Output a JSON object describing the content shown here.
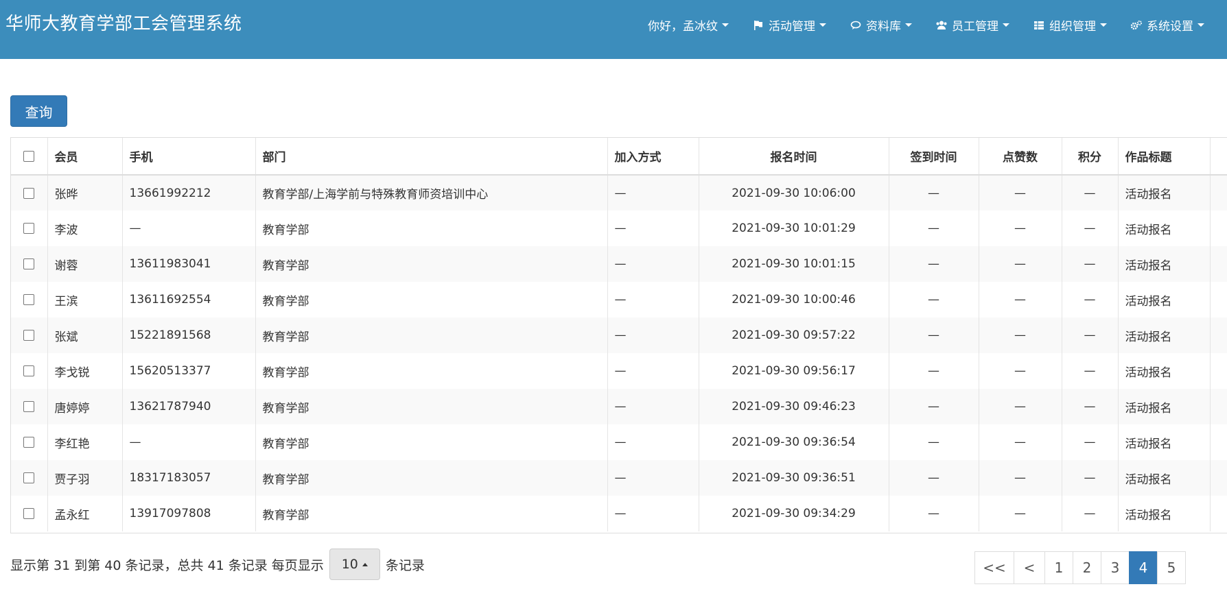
{
  "header": {
    "title": "华师大教育学部工会管理系统",
    "greeting": "你好，孟冰纹",
    "menu": [
      {
        "label": "活动管理",
        "icon": "flag-icon"
      },
      {
        "label": "资料库",
        "icon": "comments-icon"
      },
      {
        "label": "员工管理",
        "icon": "users-icon"
      },
      {
        "label": "组织管理",
        "icon": "table-icon"
      },
      {
        "label": "系统设置",
        "icon": "cogs-icon"
      }
    ]
  },
  "toolbar": {
    "query_label": "查询"
  },
  "table": {
    "columns": [
      "会员",
      "手机",
      "部门",
      "加入方式",
      "报名时间",
      "签到时间",
      "点赞数",
      "积分",
      "作品标题"
    ],
    "rows": [
      {
        "member": "张晔",
        "phone": "13661992212",
        "dept": "教育学部/上海学前与特殊教育师资培训中心",
        "join": "—",
        "signup": "2021-09-30 10:06:00",
        "checkin": "—",
        "likes": "—",
        "points": "—",
        "title": "活动报名"
      },
      {
        "member": "李波",
        "phone": "—",
        "dept": "教育学部",
        "join": "—",
        "signup": "2021-09-30 10:01:29",
        "checkin": "—",
        "likes": "—",
        "points": "—",
        "title": "活动报名"
      },
      {
        "member": "谢蓉",
        "phone": "13611983041",
        "dept": "教育学部",
        "join": "—",
        "signup": "2021-09-30 10:01:15",
        "checkin": "—",
        "likes": "—",
        "points": "—",
        "title": "活动报名"
      },
      {
        "member": "王滨",
        "phone": "13611692554",
        "dept": "教育学部",
        "join": "—",
        "signup": "2021-09-30 10:00:46",
        "checkin": "—",
        "likes": "—",
        "points": "—",
        "title": "活动报名"
      },
      {
        "member": "张斌",
        "phone": "15221891568",
        "dept": "教育学部",
        "join": "—",
        "signup": "2021-09-30 09:57:22",
        "checkin": "—",
        "likes": "—",
        "points": "—",
        "title": "活动报名"
      },
      {
        "member": "李戈锐",
        "phone": "15620513377",
        "dept": "教育学部",
        "join": "—",
        "signup": "2021-09-30 09:56:17",
        "checkin": "—",
        "likes": "—",
        "points": "—",
        "title": "活动报名"
      },
      {
        "member": "唐婷婷",
        "phone": "13621787940",
        "dept": "教育学部",
        "join": "—",
        "signup": "2021-09-30 09:46:23",
        "checkin": "—",
        "likes": "—",
        "points": "—",
        "title": "活动报名"
      },
      {
        "member": "李红艳",
        "phone": "—",
        "dept": "教育学部",
        "join": "—",
        "signup": "2021-09-30 09:36:54",
        "checkin": "—",
        "likes": "—",
        "points": "—",
        "title": "活动报名"
      },
      {
        "member": "贾子羽",
        "phone": "18317183057",
        "dept": "教育学部",
        "join": "—",
        "signup": "2021-09-30 09:36:51",
        "checkin": "—",
        "likes": "—",
        "points": "—",
        "title": "活动报名"
      },
      {
        "member": "孟永红",
        "phone": "13917097808",
        "dept": "教育学部",
        "join": "—",
        "signup": "2021-09-30 09:34:29",
        "checkin": "—",
        "likes": "—",
        "points": "—",
        "title": "活动报名"
      }
    ]
  },
  "footer": {
    "info_prefix": "显示第 31 到第 40 条记录，总共 41 条记录 每页显示",
    "page_size": "10",
    "info_suffix": "条记录"
  },
  "pagination": {
    "items": [
      "<<",
      "<",
      "1",
      "2",
      "3",
      "4",
      "5"
    ],
    "active": "4"
  },
  "colors": {
    "header_bg": "#3c8dbc",
    "primary": "#337ab7"
  }
}
